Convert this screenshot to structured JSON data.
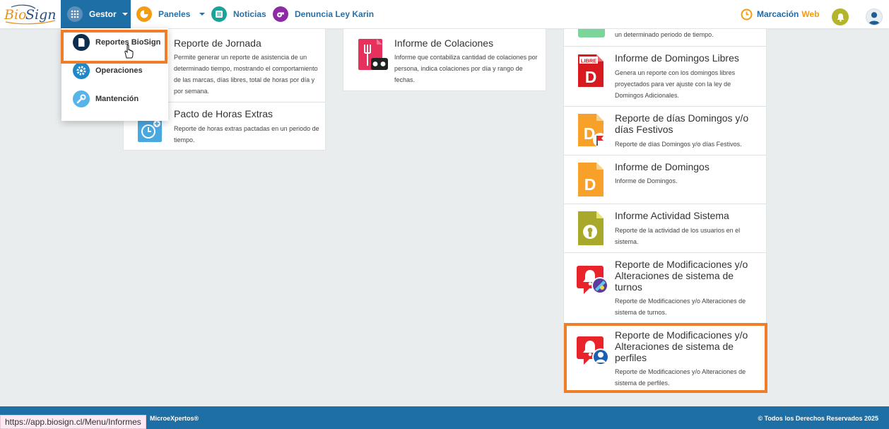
{
  "header": {
    "logo": "BioSign",
    "nav": {
      "gestor": "Gestor",
      "paneles": "Paneles",
      "noticias": "Noticias",
      "denuncia": "Denuncia Ley Karin"
    },
    "marcacion": "Marcación",
    "marcacion_web": "Web"
  },
  "dropdown": {
    "items": [
      {
        "label": "Reportes BioSign",
        "icon": "document-icon"
      },
      {
        "label": "Operaciones",
        "icon": "gear-icon"
      },
      {
        "label": "Mantención",
        "icon": "wrench-icon"
      }
    ]
  },
  "col1": [
    {
      "title": "Reporte de Jornada",
      "desc": "Permite generar un reporte de asistencia de un determinado tiempo, mostrando el comportamiento de las marcas, días libres, total de horas por día y por semana."
    },
    {
      "title": "Pacto de Horas Extras",
      "desc": "Reporte de horas extras pactadas en un periodo de tiempo."
    }
  ],
  "col2": [
    {
      "title": "Informe de Colaciones",
      "desc": "Informe que contabiliza cantidad de colaciones por persona, indica colaciones por día y rango de fechas."
    }
  ],
  "col3": {
    "partial_desc": "un determinado periodo de tiempo.",
    "items": [
      {
        "title": "Informe de Domingos Libres",
        "desc": "Genera un reporte con los domingos libres proyectados para ver ajuste con la ley de Domingos Adicionales.",
        "icon_label": "LIBRE",
        "icon_letter": "D"
      },
      {
        "title": "Reporte de días Domingos y/o días Festivos",
        "desc": "Reporte de días Domingos y/o días Festivos.",
        "icon_letter": "D"
      },
      {
        "title": "Informe de Domingos",
        "desc": "Informe de Domingos.",
        "icon_letter": "D"
      },
      {
        "title": "Informe Actividad Sistema",
        "desc": "Reporte de la actividad de los usuarios en el sistema."
      },
      {
        "title": "Reporte de Modificaciones y/o Alteraciones de sistema de turnos",
        "desc": "Reporte de Modificaciones y/o Alteraciones de sistema de turnos."
      },
      {
        "title": "Reporte de Modificaciones y/o Alteraciones de sistema de perfiles",
        "desc": "Reporte de Modificaciones y/o Alteraciones de sistema de perfiles."
      }
    ]
  },
  "footer": {
    "left": "MicroeXpertos®",
    "right": "© Todos los Derechos Reservados 2025"
  },
  "status_url": "https://app.biosign.cl/Menu/Informes",
  "colors": {
    "primary": "#1f6fa7",
    "accent_orange": "#f07d28",
    "marcacion_web": "#f39c12"
  }
}
